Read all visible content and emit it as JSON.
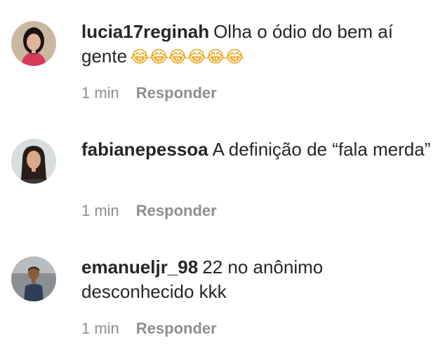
{
  "comments": [
    {
      "username": "lucia17reginah",
      "text": "Olha o ódio do bem aí gente",
      "emojis": "😂😂😂😂😂😂",
      "time": "1 min",
      "reply_label": "Responder",
      "avatar_colors": {
        "bg": "#c9b8a0",
        "hair": "#1a1210",
        "face": "#e0b49a",
        "top": "#d63a5a"
      }
    },
    {
      "username": "fabianepessoa",
      "text": "A definição de “fala merda”",
      "time": "1 min",
      "reply_label": "Responder",
      "avatar_colors": {
        "bg": "#d8dde0",
        "hair": "#2a1d18",
        "face": "#d9a98c",
        "top": "#3a3a3a"
      }
    },
    {
      "username": "emanueljr_98",
      "text": "22 no anônimo desconhecido kkk",
      "time": "1 min",
      "reply_label": "Responder",
      "avatar_colors": {
        "bg": "#8a8f94",
        "hair": "#1c1c1c",
        "face": "#8a5a3c",
        "top": "#2f3e55"
      }
    }
  ]
}
